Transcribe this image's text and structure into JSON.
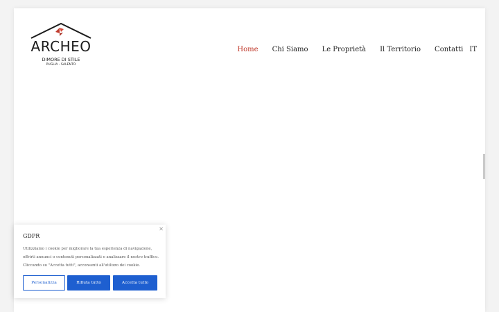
{
  "brand": {
    "name": "ARCHEO",
    "tagline": "DIMORE DI STILE",
    "region": "PUGLIA - SALENTO",
    "accent_color": "#c0392b"
  },
  "nav": {
    "items": [
      "Home",
      "Chi Siamo",
      "Le Proprietà",
      "Il Territorio",
      "Contatti"
    ],
    "active": "Home",
    "language": "IT"
  },
  "cookie_banner": {
    "title": "GDPR",
    "text": "Utilizziamo i cookie per migliorare la tua esperienza di navigazione, offrirti annunci o contenuti personalizzati e analizzare il nostro traffico. Cliccando su \"Accetta tutti\", acconsenti all'utilizzo dei cookie.",
    "close_icon": "close-icon",
    "buttons": {
      "customize": "Personalizza",
      "reject": "Rifiuta tutto",
      "accept": "Accetta tutto"
    },
    "button_color": "#1e5fd0"
  }
}
